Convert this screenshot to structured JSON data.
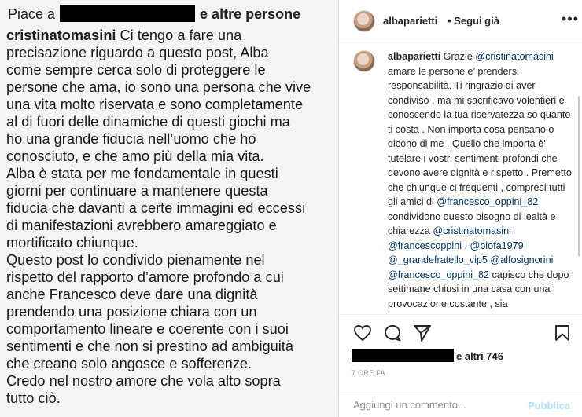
{
  "left": {
    "likes_prefix": "Piace a",
    "likes_suffix": "e altre persone",
    "comment_user": "cristinatomasini",
    "comment_body": " Ci tengo a fare una\nprecisazione riguardo a questo post, Alba\ncome sempre cerca solo di proteggere le\npersone che ama, io sono una persona che vive\nuna vita molto riservata e sono completamente\nal di fuori delle dinamiche di questi giochi ma\nho una grande fiducia nell’uomo che ho\nconosciuto, e che amo più della mia vita.\nAlba è stata per me fondamentale in questi\ngiorni per continuare a mantenere questa\nfiducia che davanti a certe immagini ed eccessi\ndi manifestazioni avrebbero amareggiato e\nmortificato chiunque.\nQuesto post lo condivido pienamente nel\nrispetto del rapporto d’amore profondo a cui\nanche Francesco deve dare una dignità\nprendendo una posizione chiara con un\ncomportamento lineare e coerente con i suoi\nsentimenti e che non si prestino ad ambiguità\nche creano solo angosce e sofferenze.\nCredo nel nostro amore che vola alto sopra\ntutto ciò."
  },
  "post": {
    "username": "albaparietti",
    "follow_label": "• Segui già",
    "more_icon": "more-icon",
    "caption_user": "albaparietti",
    "caption_parts": [
      {
        "t": " Grazie ",
        "m": false
      },
      {
        "t": "@cristinatomasini",
        "m": true
      },
      {
        "t": " amare le persone e’ prendersi responsabilità. Ti ringrazio di aver condiviso , ma mi sacrificavo volentieri e conoscendo la tua riservatezza so quanto ti costa . Non importa cosa pensano o dicono di me . Quello che importa è’ tutelare i vostri sentimenti profondi che devono avere dignità e rispetto . Premetto che chiunque ci frequenti , compresi tutti gli amici di ",
        "m": false
      },
      {
        "t": "@francesco_oppini_82",
        "m": true
      },
      {
        "t": " condividono questo bisogno di lealtà e chiarezza ",
        "m": false
      },
      {
        "t": "@cristinatomasini",
        "m": true
      },
      {
        "t": " ",
        "m": false
      },
      {
        "t": "@francescoppini",
        "m": true
      },
      {
        "t": " . ",
        "m": false
      },
      {
        "t": "@biofa1979",
        "m": true
      },
      {
        "t": " ",
        "m": false
      },
      {
        "t": "@_grandefratello_vip5",
        "m": true
      },
      {
        "t": " ",
        "m": false
      },
      {
        "t": "@alfosignorini",
        "m": true
      },
      {
        "t": " ",
        "m": false
      },
      {
        "t": "@francesco_oppini_82",
        "m": true
      },
      {
        "t": " capisco che dopo settimane chiusi in una casa con una provocazione costante , sia ",
        "m": false
      }
    ],
    "likes_suffix": "e altri 746",
    "time_label": "7 ORE FA",
    "comment_placeholder": "Aggiungi un commento...",
    "publish_label": "Pubblica"
  }
}
